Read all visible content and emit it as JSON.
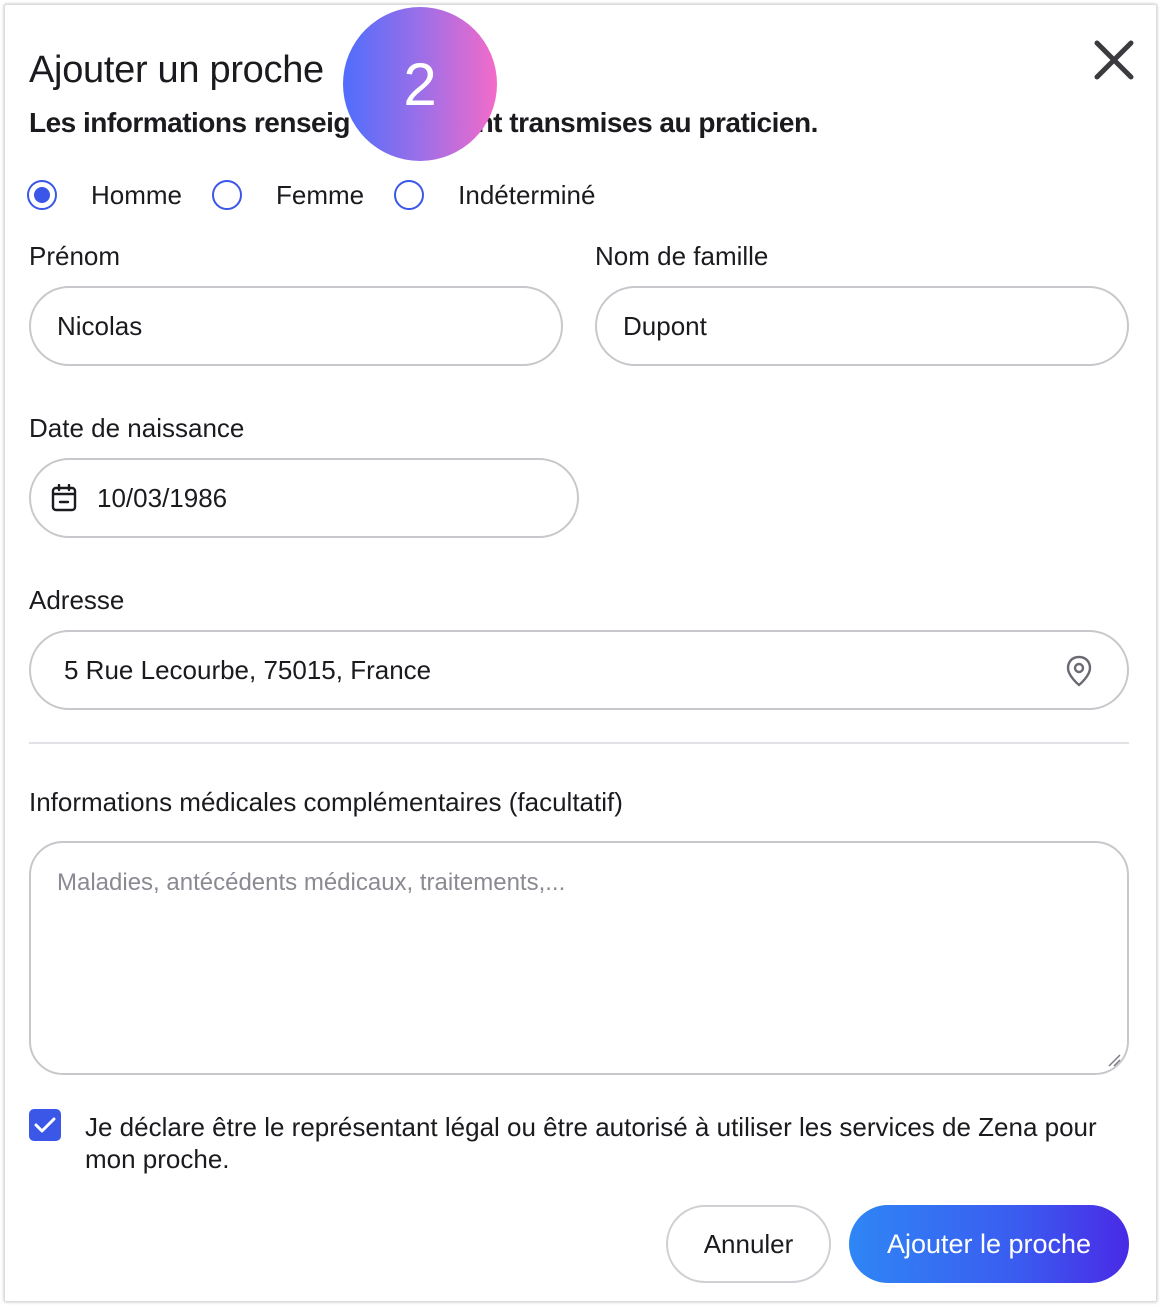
{
  "dialog": {
    "title": "Ajouter un proche",
    "subtitle": "Les informations renseig",
    "subtitle_right": "ont transmises au praticien.",
    "step_badge": "2"
  },
  "gender": {
    "options": [
      "Homme",
      "Femme",
      "Indéterminé"
    ],
    "selected": "Homme"
  },
  "form": {
    "first_name_label": "Prénom",
    "first_name_value": "Nicolas",
    "last_name_label": "Nom de famille",
    "last_name_value": "Dupont",
    "birthdate_label": "Date de naissance",
    "birthdate_value": "10/03/1986",
    "address_label": "Adresse",
    "address_value": "5 Rue Lecourbe, 75015, France",
    "medical_label": "Informations médicales complémentaires (facultatif)",
    "medical_placeholder": "Maladies, antécédents médicaux, traitements,..."
  },
  "consent": {
    "checked": true,
    "text": "Je déclare être le représentant légal ou être autorisé à utiliser les services de Zena pour mon proche."
  },
  "actions": {
    "cancel_label": "Annuler",
    "add_label": "Ajouter le proche"
  },
  "colors": {
    "accent": "#3a57e8",
    "border": "#c8c8cc",
    "add_button_gradient": [
      "#2f86f5",
      "#4a2ae6"
    ],
    "badge_gradient": [
      "#4f6dfc",
      "#f36bc9"
    ]
  },
  "icons": {
    "close": "close-icon",
    "calendar": "calendar-icon",
    "location": "location-pin-icon",
    "check": "checkmark-icon",
    "resize": "resize-handle-icon"
  }
}
